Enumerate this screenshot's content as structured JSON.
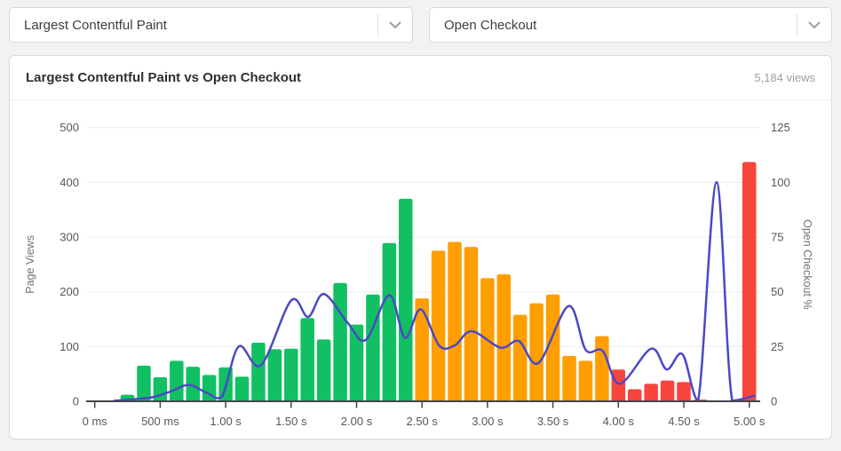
{
  "filters": {
    "metric_dropdown": {
      "value": "Largest Contentful Paint"
    },
    "event_dropdown": {
      "value": "Open Checkout"
    }
  },
  "card": {
    "title": "Largest Contentful Paint vs Open Checkout",
    "views_label": "5,184 views"
  },
  "chart_data": {
    "type": "bar",
    "subtype": "histogram-with-line-overlay",
    "title": "Largest Contentful Paint vs Open Checkout",
    "xlabel": "",
    "left_axis": {
      "label": "Page Views",
      "ticks": [
        0,
        100,
        200,
        300,
        400,
        500
      ],
      "max": 500
    },
    "right_axis": {
      "label": "Open Checkout %",
      "ticks": [
        0,
        25,
        50,
        75,
        100,
        125
      ],
      "max": 125
    },
    "x_axis": {
      "tick_times_s": [
        0,
        0.5,
        1.0,
        1.5,
        2.0,
        2.5,
        3.0,
        3.5,
        4.0,
        4.5,
        5.0
      ],
      "tick_labels": [
        "0 ms",
        "500 ms",
        "1.00 s",
        "1.50 s",
        "2.00 s",
        "2.50 s",
        "3.00 s",
        "3.50 s",
        "4.00 s",
        "4.50 s",
        "5.00 s"
      ]
    },
    "bars": {
      "series_name": "Page Views",
      "bin_start_s": 0.25,
      "bin_step_s": 0.125,
      "values": [
        12,
        65,
        44,
        74,
        63,
        48,
        62,
        45,
        107,
        95,
        96,
        152,
        113,
        216,
        140,
        195,
        289,
        370,
        188,
        275,
        291,
        282,
        225,
        232,
        158,
        179,
        195,
        83,
        74,
        119,
        58,
        22,
        32,
        38,
        35,
        3,
        1,
        1,
        437
      ]
    },
    "thresholds": {
      "green_below_s": 2.5,
      "orange_below_s": 4.0
    },
    "line_series": {
      "name": "Open Checkout %",
      "points": [
        [
          0.15,
          0.2
        ],
        [
          0.32,
          1
        ],
        [
          0.45,
          2
        ],
        [
          0.58,
          4.5
        ],
        [
          0.72,
          7.5
        ],
        [
          0.85,
          4
        ],
        [
          0.97,
          2
        ],
        [
          1.1,
          25
        ],
        [
          1.27,
          16.5
        ],
        [
          1.5,
          46
        ],
        [
          1.63,
          38.5
        ],
        [
          1.75,
          49
        ],
        [
          1.93,
          36
        ],
        [
          2.07,
          28
        ],
        [
          2.25,
          48.5
        ],
        [
          2.37,
          29
        ],
        [
          2.49,
          42
        ],
        [
          2.63,
          25.5
        ],
        [
          2.75,
          25.5
        ],
        [
          2.88,
          32
        ],
        [
          3.1,
          24.5
        ],
        [
          3.24,
          27.5
        ],
        [
          3.39,
          17.5
        ],
        [
          3.62,
          43.5
        ],
        [
          3.75,
          23.5
        ],
        [
          3.88,
          23
        ],
        [
          4.01,
          8
        ],
        [
          4.25,
          24
        ],
        [
          4.37,
          14.5
        ],
        [
          4.49,
          21.5
        ],
        [
          4.61,
          0.5
        ],
        [
          4.75,
          100
        ],
        [
          4.87,
          0.3
        ],
        [
          5.04,
          2.5
        ]
      ]
    },
    "colors": {
      "good": "#10c063",
      "needs_improvement": "#ff9e00",
      "poor": "#f8453c",
      "line": "#4b49c5",
      "grid": "#ebecee",
      "axis": "#42464b",
      "tick_text": "#54585d",
      "axis_title_text": "#6e7378"
    },
    "legend_position": "none",
    "grid": true
  }
}
